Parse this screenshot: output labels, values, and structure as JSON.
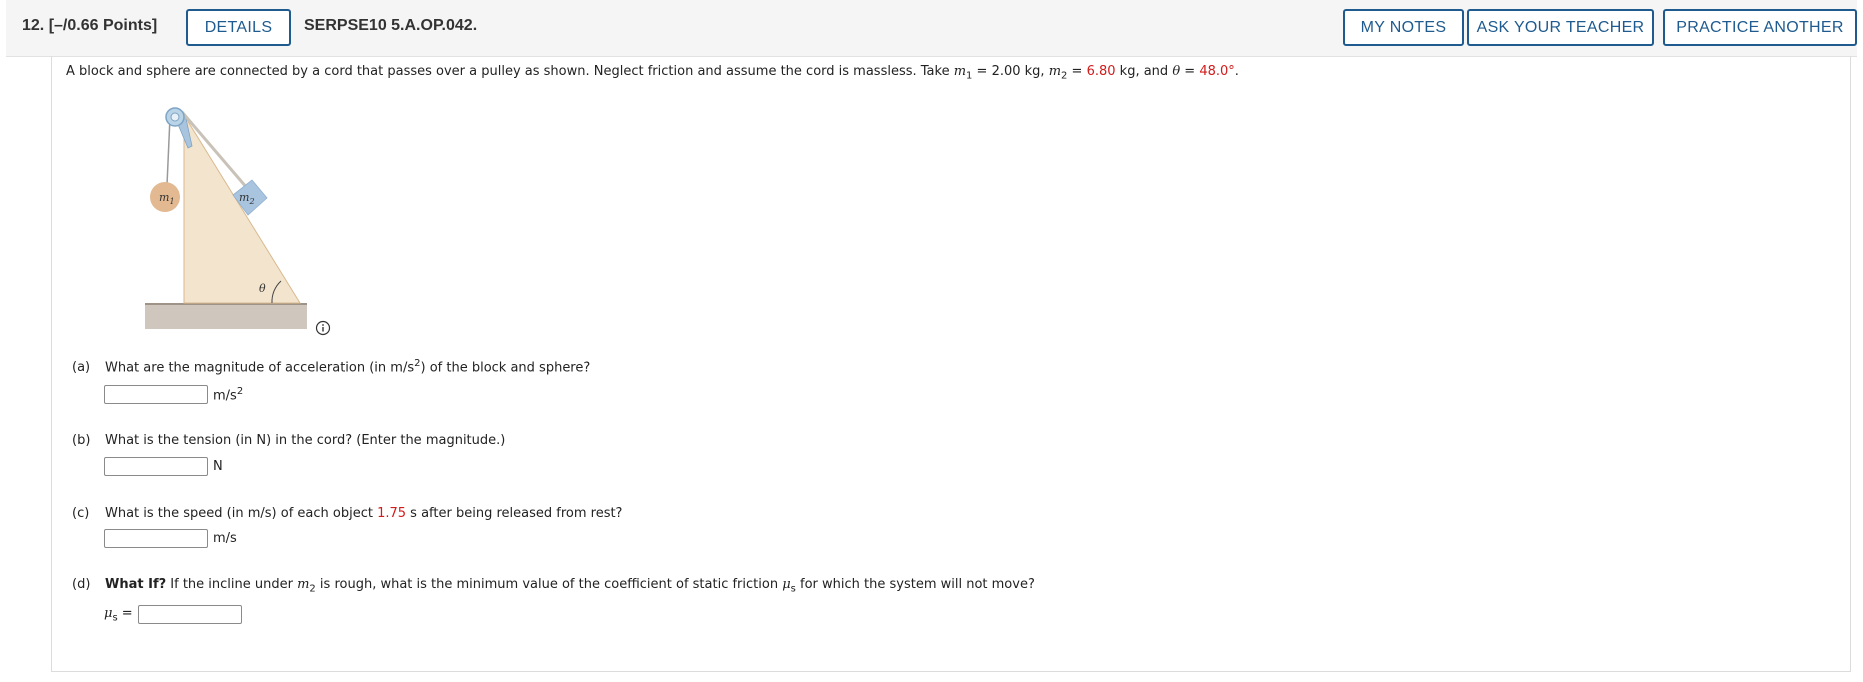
{
  "header": {
    "question_number": "12.",
    "points": "[–/0.66 Points]",
    "details_label": "DETAILS",
    "question_id": "SERPSE10 5.A.OP.042.",
    "my_notes_label": "MY NOTES",
    "ask_teacher_label": "ASK YOUR TEACHER",
    "practice_another_label": "PRACTICE ANOTHER"
  },
  "problem": {
    "intro": "A block and sphere are connected by a cord that passes over a pulley as shown. Neglect friction and assume the cord is massless. Take ",
    "m1_sym": "m",
    "m1_sub": "1",
    "m1_eq": " = 2.00 kg, ",
    "m2_sym": "m",
    "m2_sub": "2",
    "m2_eq": " = ",
    "m2_value": "6.80",
    "m2_unit": " kg, and ",
    "theta_sym": "θ",
    "theta_eq": " = ",
    "theta_value": "48.0°",
    "end": "."
  },
  "figure": {
    "m1_label": "m",
    "m1_sub": "1",
    "m2_label": "m",
    "m2_sub": "2",
    "theta_label": "θ",
    "colors": {
      "wedge": "#f3e4cd",
      "wedge_edge": "#d9b98f",
      "sphere": "#e2b991",
      "block": "#a9c4df",
      "pulley": "#b8d4e6",
      "ground": "#cfc7bd"
    }
  },
  "parts": {
    "a": {
      "letter": "(a)",
      "text": "What are the magnitude of acceleration (in m/s",
      "sup": "2",
      "text2": ") of the block and sphere?",
      "unit": "m/s",
      "unit_sup": "2"
    },
    "b": {
      "letter": "(b)",
      "text": "What is the tension (in N) in the cord? (Enter the magnitude.)",
      "unit": "N"
    },
    "c": {
      "letter": "(c)",
      "text_pre": "What is the speed (in m/s) of each object ",
      "time_value": "1.75",
      "text_post": " s after being released from rest?",
      "unit": "m/s"
    },
    "d": {
      "letter": "(d)",
      "bold": "What If?",
      "text_pre": " If the incline under ",
      "m_sym": "m",
      "m_sub": "2",
      "text_post": " is rough, what is the minimum value of the coefficient of static friction ",
      "mu_sym": "μ",
      "mu_sub": "s",
      "text_end": " for which the system will not move?",
      "answer_label_sym": "μ",
      "answer_label_sub": "s",
      "answer_label_eq": " ="
    }
  }
}
